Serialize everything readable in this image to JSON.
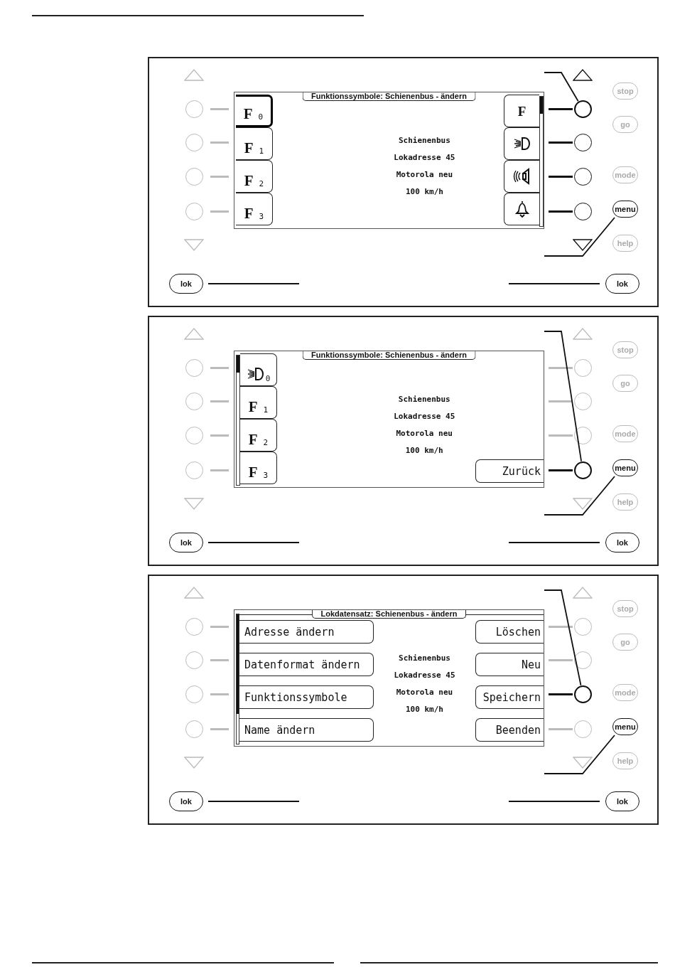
{
  "panels": [
    {
      "screen": {
        "title": "Funktionssymbole: Schienenbus - ändern",
        "title_rule": false,
        "right_scrollbar": {
          "long_thumb": false
        },
        "info": [
          "Schienenbus",
          "Lokadresse 45",
          "Motorola neu",
          "100 km/h"
        ],
        "left_softkeys": [
          {
            "kind": "function",
            "symbol": "F",
            "index": "0",
            "selected": true
          },
          {
            "kind": "function",
            "symbol": "F",
            "index": "1",
            "selected": false
          },
          {
            "kind": "function",
            "symbol": "F",
            "index": "2",
            "selected": false
          },
          {
            "kind": "function",
            "symbol": "F",
            "index": "3",
            "selected": false
          }
        ],
        "right_softkeys": [
          {
            "kind": "letter",
            "symbol": "F",
            "selected": false
          },
          {
            "kind": "light",
            "selected": false
          },
          {
            "kind": "sound",
            "selected": false
          },
          {
            "kind": "bell",
            "selected": false
          }
        ]
      },
      "left_keys": [
        {
          "active": false
        },
        {
          "active": false
        },
        {
          "active": false
        },
        {
          "active": false
        }
      ],
      "right_keys": [
        {
          "active": true,
          "pointed": true
        },
        {
          "active": true,
          "pointed": false
        },
        {
          "active": true,
          "pointed": false
        },
        {
          "active": true,
          "pointed": false
        }
      ],
      "arrows": {
        "left_active": false,
        "right_active": true
      },
      "side_buttons": [
        {
          "label": "stop",
          "active": false
        },
        {
          "label": "go",
          "active": false
        },
        {
          "label": "mode",
          "active": false
        },
        {
          "label": "menu",
          "active": true
        },
        {
          "label": "help",
          "active": false
        }
      ],
      "lok_buttons": [
        {
          "label": "lok"
        },
        {
          "label": "lok"
        }
      ]
    },
    {
      "screen": {
        "title": "Funktionssymbole: Schienenbus - ändern",
        "title_rule": false,
        "left_scrollbar": {
          "long_thumb": false
        },
        "info": [
          "Schienenbus",
          "Lokadresse 45",
          "Motorola neu",
          "100 km/h"
        ],
        "left_softkeys": [
          {
            "kind": "light_function",
            "index": "0",
            "selected": false
          },
          {
            "kind": "function",
            "symbol": "F",
            "index": "1",
            "selected": false
          },
          {
            "kind": "function",
            "symbol": "F",
            "index": "2",
            "selected": false
          },
          {
            "kind": "function",
            "symbol": "F",
            "index": "3",
            "selected": false
          }
        ],
        "right_softkeys": [
          {
            "kind": "blank"
          },
          {
            "kind": "blank"
          },
          {
            "kind": "blank"
          },
          {
            "kind": "text",
            "label": "Zurück",
            "selected": false
          }
        ]
      },
      "left_keys": [
        {
          "active": false
        },
        {
          "active": false
        },
        {
          "active": false
        },
        {
          "active": false
        }
      ],
      "right_keys": [
        {
          "active": false,
          "pointed": false
        },
        {
          "active": false,
          "pointed": false
        },
        {
          "active": false,
          "pointed": false
        },
        {
          "active": true,
          "pointed": true
        }
      ],
      "arrows": {
        "left_active": false,
        "right_active": false
      },
      "side_buttons": [
        {
          "label": "stop",
          "active": false
        },
        {
          "label": "go",
          "active": false
        },
        {
          "label": "mode",
          "active": false
        },
        {
          "label": "menu",
          "active": true
        },
        {
          "label": "help",
          "active": false
        }
      ],
      "lok_buttons": [
        {
          "label": "lok"
        },
        {
          "label": "lok"
        }
      ]
    },
    {
      "screen": {
        "title": "Lokdatensatz: Schienenbus - ändern",
        "title_rule": true,
        "left_scrollbar": {
          "long_thumb": true
        },
        "info": [
          "Schienenbus",
          "Lokadresse 45",
          "Motorola neu",
          "100 km/h"
        ],
        "left_softkeys": [
          {
            "kind": "text",
            "label": "Adresse ändern",
            "selected": false
          },
          {
            "kind": "text",
            "label": "Datenformat ändern",
            "selected": false
          },
          {
            "kind": "text",
            "label": "Funktionssymbole",
            "selected": false
          },
          {
            "kind": "text",
            "label": "Name ändern",
            "selected": false
          }
        ],
        "right_softkeys": [
          {
            "kind": "text",
            "label": "Löschen",
            "selected": false
          },
          {
            "kind": "text",
            "label": "Neu",
            "selected": false
          },
          {
            "kind": "text",
            "label": "Speichern",
            "selected": false
          },
          {
            "kind": "text",
            "label": "Beenden",
            "selected": false
          }
        ]
      },
      "left_keys": [
        {
          "active": false
        },
        {
          "active": false
        },
        {
          "active": false
        },
        {
          "active": false
        }
      ],
      "right_keys": [
        {
          "active": false,
          "pointed": false
        },
        {
          "active": false,
          "pointed": false
        },
        {
          "active": true,
          "pointed": true
        },
        {
          "active": false,
          "pointed": false
        }
      ],
      "arrows": {
        "left_active": false,
        "right_active": false
      },
      "side_buttons": [
        {
          "label": "stop",
          "active": false
        },
        {
          "label": "go",
          "active": false
        },
        {
          "label": "mode",
          "active": false
        },
        {
          "label": "menu",
          "active": true
        },
        {
          "label": "help",
          "active": false
        }
      ],
      "lok_buttons": [
        {
          "label": "lok"
        },
        {
          "label": "lok"
        }
      ]
    }
  ]
}
